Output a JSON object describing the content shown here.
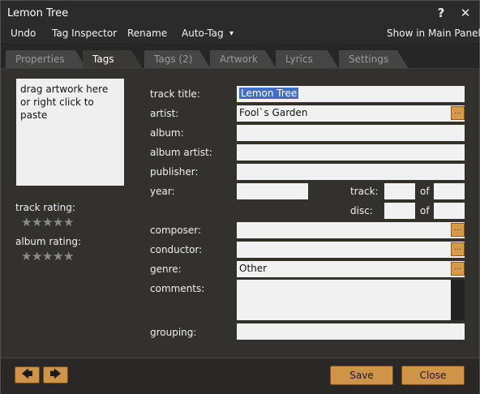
{
  "window": {
    "title": "Lemon Tree",
    "help_icon": "help-icon",
    "close_icon": "close-icon",
    "help_glyph": "?",
    "close_glyph": "✕"
  },
  "menu": {
    "undo": "Undo",
    "tag_inspector": "Tag Inspector",
    "rename": "Rename",
    "auto_tag": "Auto-Tag",
    "auto_tag_arrow": "▾",
    "show_in_main_panel": "Show in Main Panel"
  },
  "tabs": [
    {
      "label": "Properties",
      "active": false
    },
    {
      "label": "Tags",
      "active": true
    },
    {
      "label": "Tags (2)",
      "active": false
    },
    {
      "label": "Artwork",
      "active": false
    },
    {
      "label": "Lyrics",
      "active": false
    },
    {
      "label": "Settings",
      "active": false
    }
  ],
  "artwork": {
    "hint": "drag artwork here or right click to paste"
  },
  "ratings": {
    "track_label": "track rating:",
    "album_label": "album rating:",
    "track_value": 0,
    "album_value": 0,
    "max": 5,
    "star_glyph": "★"
  },
  "fields": {
    "track_title": {
      "label": "track title:",
      "value": "Lemon Tree"
    },
    "artist": {
      "label": "artist:",
      "value": "Fool`s Garden"
    },
    "album": {
      "label": "album:",
      "value": ""
    },
    "album_artist": {
      "label": "album artist:",
      "value": ""
    },
    "publisher": {
      "label": "publisher:",
      "value": ""
    },
    "year": {
      "label": "year:",
      "value": ""
    },
    "track": {
      "label": "track:",
      "value": "",
      "of_label": "of",
      "of_value": ""
    },
    "disc": {
      "label": "disc:",
      "value": "",
      "of_label": "of",
      "of_value": ""
    },
    "composer": {
      "label": "composer:",
      "value": ""
    },
    "conductor": {
      "label": "conductor:",
      "value": ""
    },
    "genre": {
      "label": "genre:",
      "value": "Other"
    },
    "comments": {
      "label": "comments:",
      "value": ""
    },
    "grouping": {
      "label": "grouping:",
      "value": ""
    }
  },
  "picker_glyph": "...",
  "buttons": {
    "prev_glyph": "🡄",
    "next_glyph": "🡆",
    "save": "Save",
    "close": "Close"
  },
  "colors": {
    "accent_button": "#d09449",
    "selection": "#3f6fc7",
    "active_tab": "#3b3935",
    "inactive_tab": "#454545"
  }
}
